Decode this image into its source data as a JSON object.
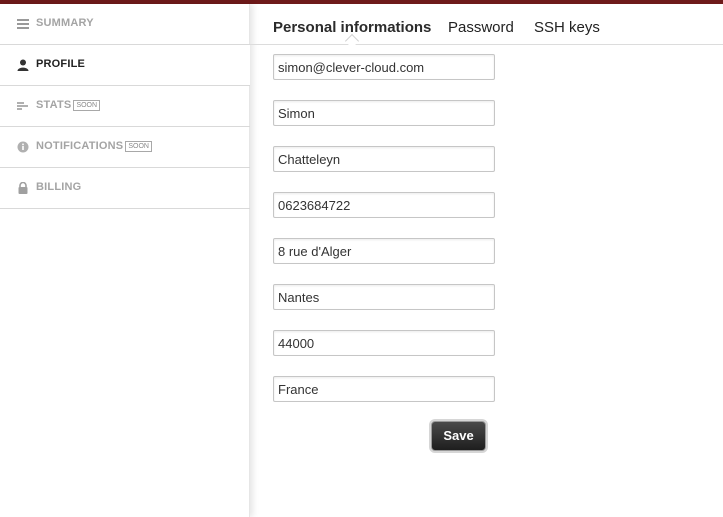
{
  "sidebar": {
    "items": [
      {
        "label": "SUMMARY",
        "icon": "list-icon",
        "badge": null,
        "active": false
      },
      {
        "label": "PROFILE",
        "icon": "user-icon",
        "badge": null,
        "active": true
      },
      {
        "label": "STATS",
        "icon": "stats-icon",
        "badge": "SOON",
        "active": false
      },
      {
        "label": "NOTIFICATIONS",
        "icon": "info-icon",
        "badge": "SOON",
        "active": false
      },
      {
        "label": "BILLING",
        "icon": "lock-icon",
        "badge": null,
        "active": false
      }
    ]
  },
  "tabs": {
    "personal": "Personal informations",
    "password": "Password",
    "ssh": "SSH keys",
    "active": "personal"
  },
  "form": {
    "email": "simon@clever-cloud.com",
    "first_name": "Simon",
    "last_name": "Chatteleyn",
    "phone": "0623684722",
    "address": "8 rue d'Alger",
    "city": "Nantes",
    "zipcode": "44000",
    "country": "France",
    "save_label": "Save"
  },
  "colors": {
    "topbar": "#6e1a1a",
    "active_text": "#222222",
    "inactive_text": "#a4a4a4",
    "button": "#2b2b2b"
  }
}
